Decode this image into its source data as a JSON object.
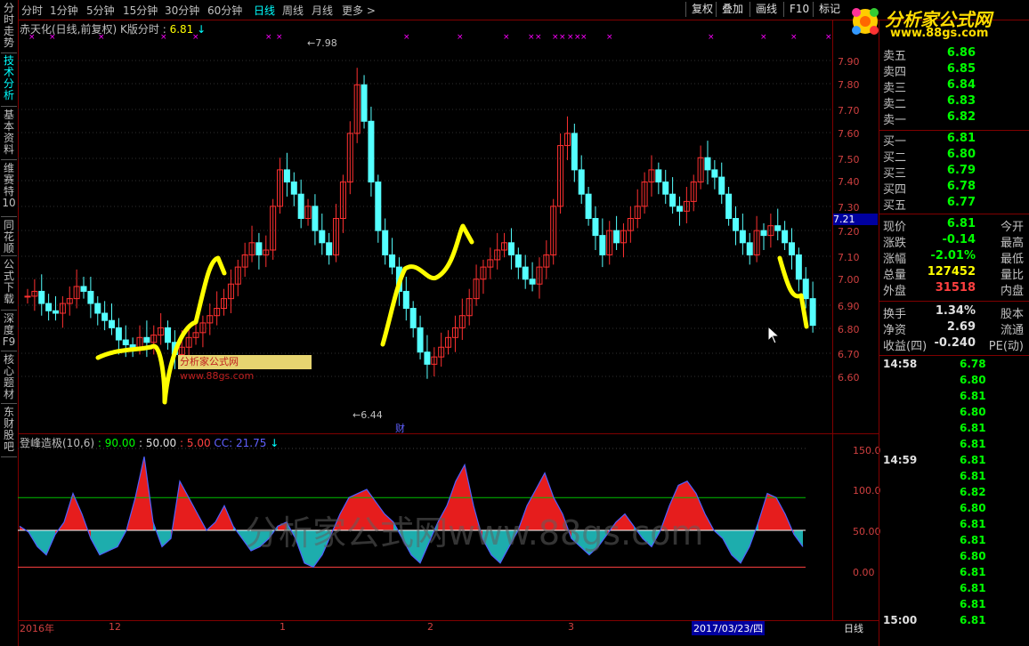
{
  "toolbar": {
    "periods": [
      "分时",
      "1分钟",
      "5分钟",
      "15分钟",
      "30分钟",
      "60分钟",
      "日线",
      "周线",
      "月线",
      "更多 >"
    ],
    "active_period": "日线",
    "buttons": [
      "复权",
      "叠加",
      "画线",
      "F10",
      "标记"
    ]
  },
  "left_tabs": [
    {
      "label": "分时走势",
      "active": false
    },
    {
      "label": "技术分析",
      "active": true
    },
    {
      "label": "基本资料",
      "active": false
    },
    {
      "label": "维赛特10",
      "active": false
    },
    {
      "label": "同花顺",
      "active": false
    },
    {
      "label": "公式下载",
      "active": false
    },
    {
      "label": "深度F9",
      "active": false
    },
    {
      "label": "核心题材",
      "active": false
    },
    {
      "label": "东财股吧",
      "active": false
    }
  ],
  "main": {
    "stock_name": "赤天化(日线,前复权)",
    "indicator": "K版分时 :",
    "indicator_value": "6.81",
    "high_marker": "7.98",
    "low_marker": "6.44",
    "cai_badge": "财",
    "current_price_tag": "7.21",
    "watermark_label": "分析家公式网www.88gs.com",
    "price_axis": [
      "7.90",
      "7.80",
      "7.70",
      "7.60",
      "7.50",
      "7.40",
      "7.30",
      "7.20",
      "7.10",
      "7.00",
      "6.90",
      "6.80",
      "6.70",
      "6.60"
    ]
  },
  "osc": {
    "title": "登峰造极(10,6)",
    "l1_label": ": 90.00",
    "l2_label": ": 50.00",
    "l3_label": ": 5.00",
    "cc_label": "CC: 21.75",
    "axis": [
      "150.0",
      "100.0",
      "50.00",
      "0.00"
    ],
    "watermark": "分析家公式网www.88gs.com"
  },
  "date_axis": {
    "labels": [
      "2016年",
      "12",
      "1",
      "2",
      "3"
    ],
    "highlight": "2017/03/23/四",
    "period": "日线"
  },
  "logo": {
    "name": "分析家公式网",
    "url": "www.88gs.com"
  },
  "quote": {
    "asks": [
      {
        "label": "卖五",
        "price": "6.86"
      },
      {
        "label": "卖四",
        "price": "6.85"
      },
      {
        "label": "卖三",
        "price": "6.84"
      },
      {
        "label": "卖二",
        "price": "6.83"
      },
      {
        "label": "卖一",
        "price": "6.82"
      }
    ],
    "bids": [
      {
        "label": "买一",
        "price": "6.81"
      },
      {
        "label": "买二",
        "price": "6.80"
      },
      {
        "label": "买三",
        "price": "6.79"
      },
      {
        "label": "买四",
        "price": "6.78"
      },
      {
        "label": "买五",
        "price": "6.77"
      }
    ],
    "stats": [
      {
        "label": "现价",
        "value": "6.81",
        "color": "green",
        "label2": "今开"
      },
      {
        "label": "涨跌",
        "value": "-0.14",
        "color": "green",
        "label2": "最高"
      },
      {
        "label": "涨幅",
        "value": "-2.01%",
        "color": "green",
        "label2": "最低"
      },
      {
        "label": "总量",
        "value": "127452",
        "color": "yellow",
        "label2": "量比"
      },
      {
        "label": "外盘",
        "value": "31518",
        "color": "red",
        "label2": "内盘"
      }
    ],
    "fund": [
      {
        "label": "换手",
        "value": "1.34%",
        "label2": "股本"
      },
      {
        "label": "净资",
        "value": "2.69",
        "label2": "流通"
      },
      {
        "label": "收益(四)",
        "value": "-0.240",
        "label2": "PE(动)"
      }
    ]
  },
  "ticks": [
    {
      "time": "14:58",
      "prices": [
        "6.78",
        "6.80",
        "6.81",
        "6.80",
        "6.81",
        "6.81"
      ]
    },
    {
      "time": "14:59",
      "prices": [
        "6.81",
        "6.81",
        "6.82",
        "6.80",
        "6.81",
        "6.81",
        "6.80",
        "6.81",
        "6.81",
        "6.81"
      ]
    },
    {
      "time": "15:00",
      "prices": [
        "6.81"
      ]
    }
  ]
}
